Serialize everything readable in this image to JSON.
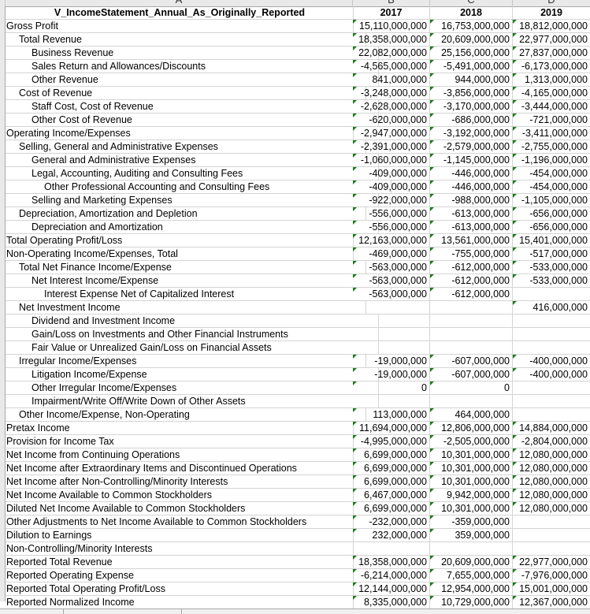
{
  "columns": [
    "A",
    "B",
    "C",
    "D"
  ],
  "header": {
    "title": "V_IncomeStatement_Annual_As_Originally_Reported",
    "years": [
      "2017",
      "2018",
      "2019"
    ]
  },
  "rows": [
    {
      "label": "Gross Profit",
      "indent": 0,
      "values": [
        "15,110,000,000",
        "16,753,000,000",
        "18,812,000,000"
      ]
    },
    {
      "label": "Total Revenue",
      "indent": 1,
      "values": [
        "18,358,000,000",
        "20,609,000,000",
        "22,977,000,000"
      ]
    },
    {
      "label": "Business Revenue",
      "indent": 2,
      "values": [
        "22,082,000,000",
        "25,156,000,000",
        "27,837,000,000"
      ]
    },
    {
      "label": "Sales Return and Allowances/Discounts",
      "indent": 2,
      "values": [
        "-4,565,000,000",
        "-5,491,000,000",
        "-6,173,000,000"
      ]
    },
    {
      "label": "Other Revenue",
      "indent": 2,
      "values": [
        "841,000,000",
        "944,000,000",
        "1,313,000,000"
      ]
    },
    {
      "label": "Cost of Revenue",
      "indent": 1,
      "values": [
        "-3,248,000,000",
        "-3,856,000,000",
        "-4,165,000,000"
      ]
    },
    {
      "label": "Staff Cost, Cost of Revenue",
      "indent": 2,
      "values": [
        "-2,628,000,000",
        "-3,170,000,000",
        "-3,444,000,000"
      ]
    },
    {
      "label": "Other Cost of Revenue",
      "indent": 2,
      "values": [
        "-620,000,000",
        "-686,000,000",
        "-721,000,000"
      ]
    },
    {
      "label": "Operating Income/Expenses",
      "indent": 0,
      "values": [
        "-2,947,000,000",
        "-3,192,000,000",
        "-3,411,000,000"
      ]
    },
    {
      "label": "Selling, General and Administrative Expenses",
      "indent": 1,
      "values": [
        "-2,391,000,000",
        "-2,579,000,000",
        "-2,755,000,000"
      ]
    },
    {
      "label": "General and Administrative Expenses",
      "indent": 2,
      "values": [
        "-1,060,000,000",
        "-1,145,000,000",
        "-1,196,000,000"
      ]
    },
    {
      "label": "Legal, Accounting, Auditing and Consulting Fees",
      "indent": 2,
      "values": [
        "-409,000,000",
        "-446,000,000",
        "-454,000,000"
      ]
    },
    {
      "label": "Other Professional Accounting and Consulting Fees",
      "indent": 3,
      "values": [
        "-409,000,000",
        "-446,000,000",
        "-454,000,000"
      ]
    },
    {
      "label": "Selling and Marketing Expenses",
      "indent": 2,
      "values": [
        "-922,000,000",
        "-988,000,000",
        "-1,105,000,000"
      ]
    },
    {
      "label": "Depreciation, Amortization and Depletion",
      "indent": 1,
      "values": [
        "-556,000,000",
        "-613,000,000",
        "-656,000,000"
      ]
    },
    {
      "label": "Depreciation and Amortization",
      "indent": 2,
      "values": [
        "-556,000,000",
        "-613,000,000",
        "-656,000,000"
      ]
    },
    {
      "label": "Total Operating Profit/Loss",
      "indent": 0,
      "values": [
        "12,163,000,000",
        "13,561,000,000",
        "15,401,000,000"
      ]
    },
    {
      "label": "Non-Operating Income/Expenses, Total",
      "indent": 0,
      "values": [
        "-469,000,000",
        "-755,000,000",
        "-517,000,000"
      ]
    },
    {
      "label": "Total Net Finance Income/Expense",
      "indent": 1,
      "values": [
        "-563,000,000",
        "-612,000,000",
        "-533,000,000"
      ]
    },
    {
      "label": "Net Interest Income/Expense",
      "indent": 2,
      "values": [
        "-563,000,000",
        "-612,000,000",
        "-533,000,000"
      ]
    },
    {
      "label": "Interest Expense Net of Capitalized Interest",
      "indent": 3,
      "values": [
        "-563,000,000",
        "-612,000,000",
        ""
      ]
    },
    {
      "label": "Net Investment Income",
      "indent": 1,
      "values": [
        "",
        "",
        "416,000,000"
      ]
    },
    {
      "label": "Dividend and Investment Income",
      "indent": 2,
      "values": [
        "",
        "",
        ""
      ]
    },
    {
      "label": "Gain/Loss on Investments and Other Financial Instruments",
      "indent": 2,
      "values": [
        "",
        "",
        ""
      ]
    },
    {
      "label": "Fair Value or Unrealized Gain/Loss on Financial Assets",
      "indent": 2,
      "values": [
        "",
        "",
        ""
      ]
    },
    {
      "label": "Irregular Income/Expenses",
      "indent": 1,
      "values": [
        "-19,000,000",
        "-607,000,000",
        "-400,000,000"
      ]
    },
    {
      "label": "Litigation Income/Expense",
      "indent": 2,
      "values": [
        "-19,000,000",
        "-607,000,000",
        "-400,000,000"
      ]
    },
    {
      "label": "Other Irregular Income/Expenses",
      "indent": 2,
      "values": [
        "0",
        "0",
        ""
      ]
    },
    {
      "label": "Impairment/Write Off/Write Down of Other Assets",
      "indent": 2,
      "values": [
        "",
        "",
        ""
      ]
    },
    {
      "label": "Other Income/Expense, Non-Operating",
      "indent": 1,
      "values": [
        "113,000,000",
        "464,000,000",
        ""
      ]
    },
    {
      "label": "Pretax Income",
      "indent": 0,
      "values": [
        "11,694,000,000",
        "12,806,000,000",
        "14,884,000,000"
      ]
    },
    {
      "label": "Provision for Income Tax",
      "indent": 0,
      "values": [
        "-4,995,000,000",
        "-2,505,000,000",
        "-2,804,000,000"
      ]
    },
    {
      "label": "Net Income from Continuing Operations",
      "indent": 0,
      "values": [
        "6,699,000,000",
        "10,301,000,000",
        "12,080,000,000"
      ]
    },
    {
      "label": "Net Income after Extraordinary Items and Discontinued Operations",
      "indent": 0,
      "values": [
        "6,699,000,000",
        "10,301,000,000",
        "12,080,000,000"
      ]
    },
    {
      "label": "Net Income after Non-Controlling/Minority Interests",
      "indent": 0,
      "values": [
        "6,699,000,000",
        "10,301,000,000",
        "12,080,000,000"
      ]
    },
    {
      "label": "Net Income Available to Common Stockholders",
      "indent": 0,
      "values": [
        "6,467,000,000",
        "9,942,000,000",
        "12,080,000,000"
      ]
    },
    {
      "label": "Diluted Net Income Available to Common Stockholders",
      "indent": 0,
      "values": [
        "6,699,000,000",
        "10,301,000,000",
        "12,080,000,000"
      ]
    },
    {
      "label": "Other Adjustments to Net Income Available to Common Stockholders",
      "indent": 0,
      "values": [
        "-232,000,000",
        "-359,000,000",
        ""
      ]
    },
    {
      "label": "Dilution to Earnings",
      "indent": 0,
      "values": [
        "232,000,000",
        "359,000,000",
        ""
      ]
    },
    {
      "label": "Non-Controlling/Minority Interests",
      "indent": 0,
      "values": [
        "",
        "",
        ""
      ]
    },
    {
      "label": "Reported Total Revenue",
      "indent": 0,
      "values": [
        "18,358,000,000",
        "20,609,000,000",
        "22,977,000,000"
      ]
    },
    {
      "label": "Reported Operating Expense",
      "indent": 0,
      "values": [
        "-6,214,000,000",
        "7,655,000,000",
        "-7,976,000,000"
      ]
    },
    {
      "label": "Reported Total Operating Profit/Loss",
      "indent": 0,
      "values": [
        "12,144,000,000",
        "12,954,000,000",
        "15,001,000,000"
      ]
    },
    {
      "label": "Reported Normalized Income",
      "indent": 0,
      "values": [
        "8,335,000,000",
        "10,729,000,000",
        "12,367,000,000"
      ]
    }
  ],
  "colors": {
    "error_indicator": "#1d7a1d",
    "gridline": "#d4d4d4",
    "header_bg": "#e9e9e9"
  }
}
